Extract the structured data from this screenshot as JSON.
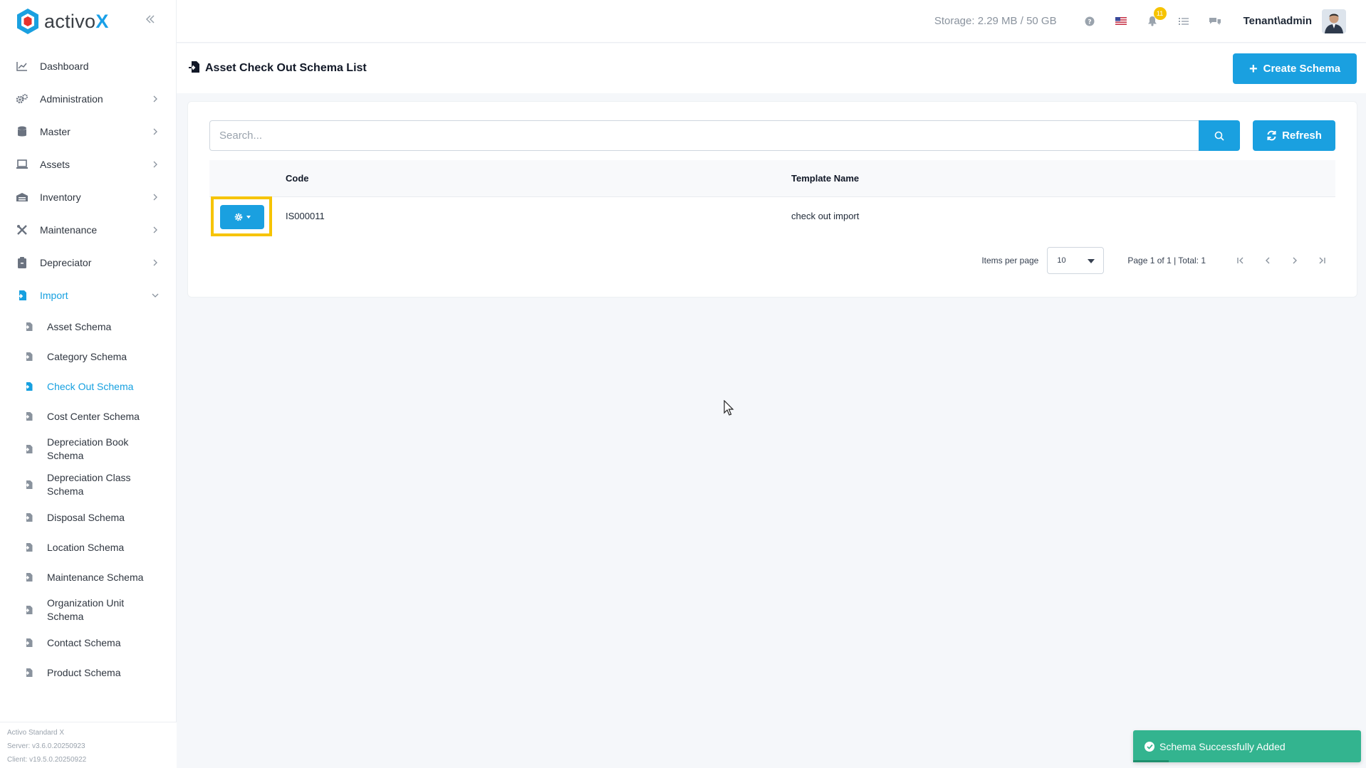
{
  "app": {
    "brand_prefix": "activo",
    "brand_suffix": "X"
  },
  "header": {
    "storage": "Storage: 2.29 MB / 50 GB",
    "notification_count": "11",
    "user": "Tenant\\admin"
  },
  "sidebar": {
    "items": [
      {
        "label": "Dashboard",
        "icon": "chart-icon"
      },
      {
        "label": "Administration",
        "icon": "gears-icon"
      },
      {
        "label": "Master",
        "icon": "database-icon"
      },
      {
        "label": "Assets",
        "icon": "laptop-icon"
      },
      {
        "label": "Inventory",
        "icon": "warehouse-icon"
      },
      {
        "label": "Maintenance",
        "icon": "tools-icon"
      },
      {
        "label": "Depreciator",
        "icon": "clipboard-icon"
      },
      {
        "label": "Import",
        "icon": "import-icon"
      }
    ],
    "import_sub": [
      "Asset Schema",
      "Category Schema",
      "Check Out Schema",
      "Cost Center Schema",
      "Depreciation Book Schema",
      "Depreciation Class Schema",
      "Disposal Schema",
      "Location Schema",
      "Maintenance Schema",
      "Organization Unit Schema",
      "Contact Schema",
      "Product Schema"
    ],
    "active_sub": "Check Out Schema",
    "footer": {
      "product": "Activo Standard X",
      "server": "Server: v3.6.0.20250923",
      "client": "Client: v19.5.0.20250922"
    }
  },
  "page": {
    "title": "Asset Check Out Schema List",
    "create_label": "Create Schema",
    "search_placeholder": "Search...",
    "refresh_label": "Refresh"
  },
  "table": {
    "columns": [
      "",
      "Code",
      "Template Name"
    ],
    "rows": [
      {
        "code": "IS000011",
        "template": "check out import"
      }
    ]
  },
  "pager": {
    "items_per_page_label": "Items per page",
    "items_per_page": "10",
    "page_info": "Page 1 of 1 | Total: 1"
  },
  "toast": {
    "message": "Schema Successfully Added"
  },
  "colors": {
    "accent": "#1aa0e0",
    "toast": "#33b48f",
    "highlight": "#f6c400"
  }
}
